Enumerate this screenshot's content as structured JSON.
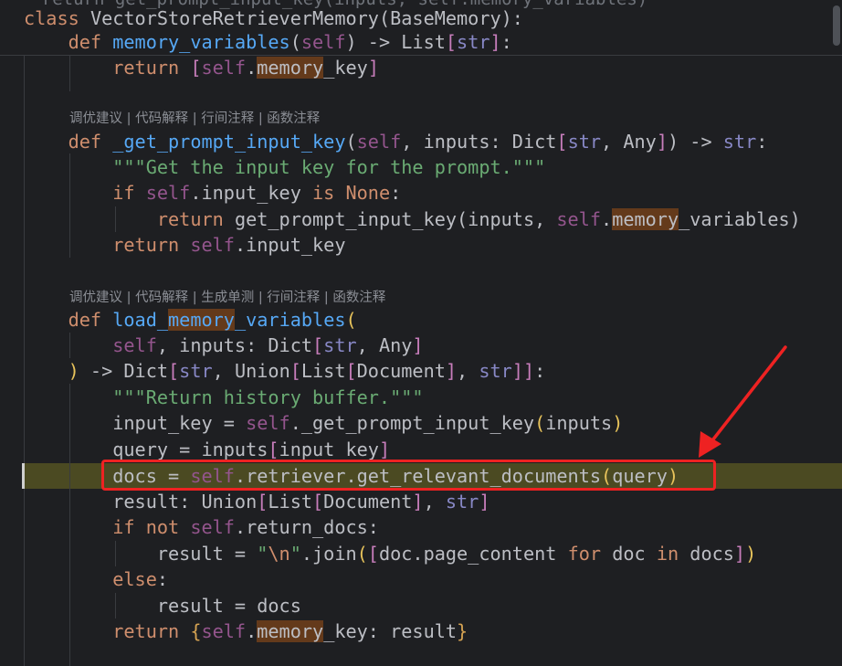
{
  "editor": {
    "hints": {
      "h1": "调优建议 | 代码解释 | 行间注释 | 函数注释",
      "h2": "调优建议 | 代码解释 | 生成单测 | 行间注释 | 函数注释"
    },
    "annotation": {
      "box_color": "#ee2222",
      "note": "red box and arrow highlight the get_relevant_documents call"
    },
    "colors": {
      "background": "#1e1f22",
      "keyword": "#cf8e6d",
      "function": "#56a8f5",
      "string": "#6aab73",
      "self": "#94558d",
      "current_line": "#4b4a22",
      "search_highlight": "#643a1b"
    }
  }
}
